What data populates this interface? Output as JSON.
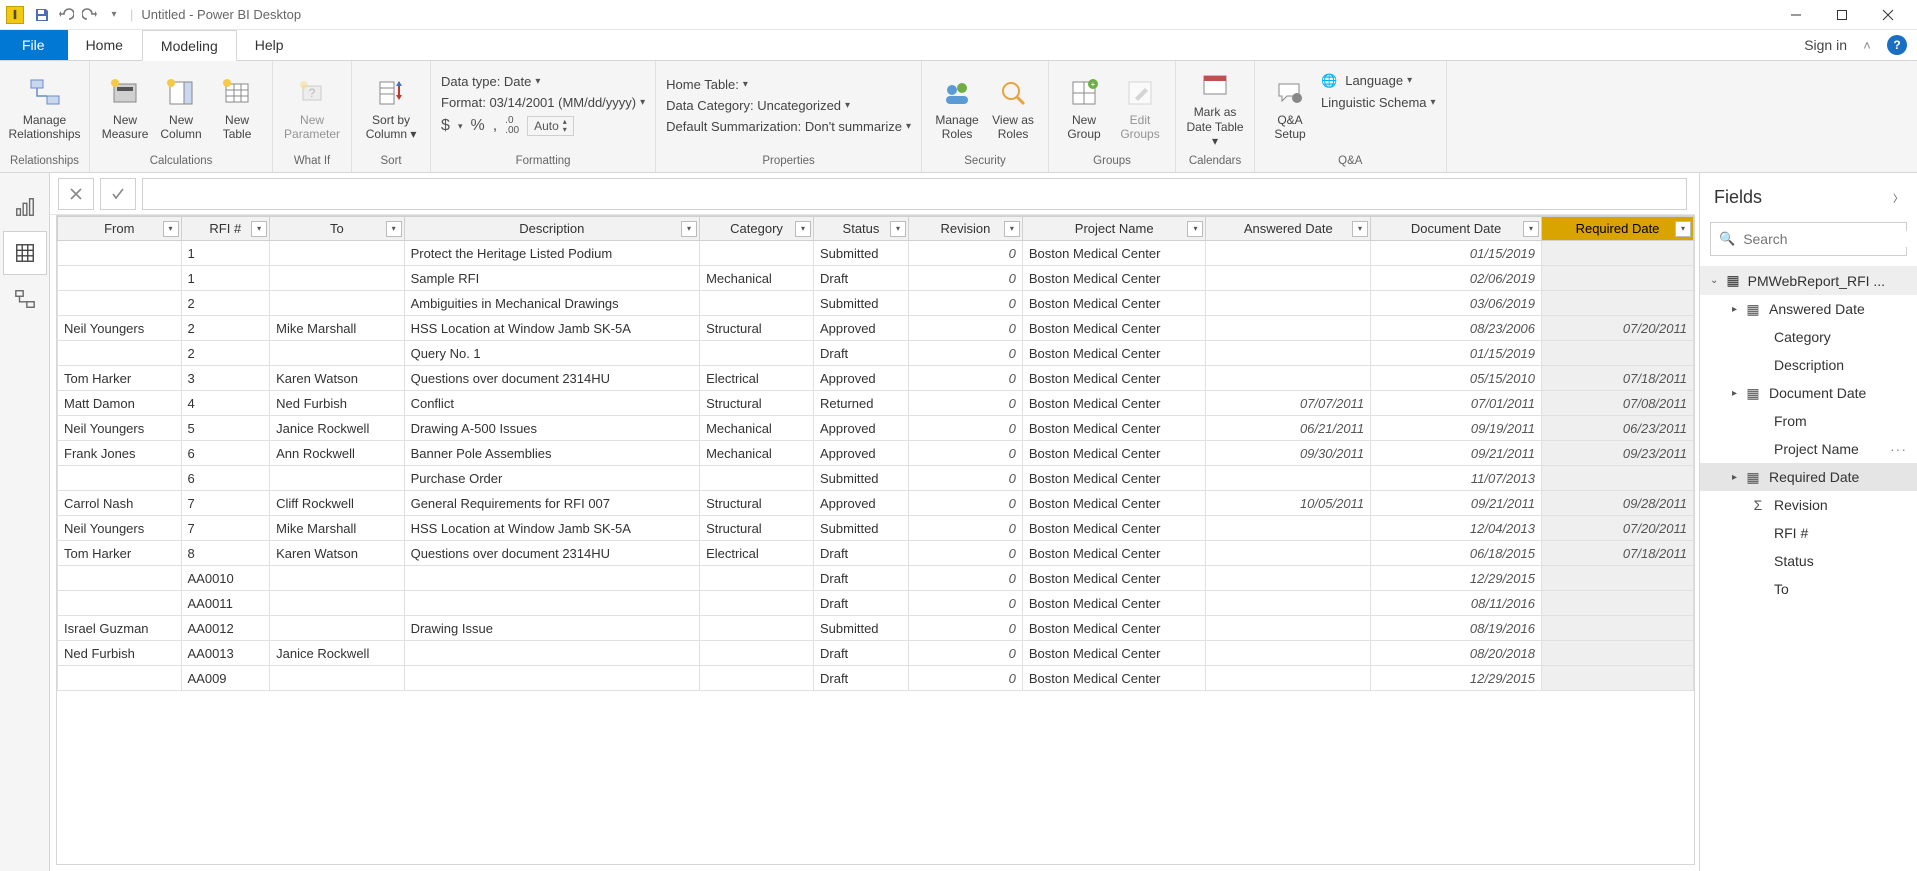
{
  "titlebar": {
    "title": "Untitled - Power BI Desktop"
  },
  "menubar": {
    "file": "File",
    "home": "Home",
    "modeling": "Modeling",
    "help": "Help",
    "signin": "Sign in"
  },
  "ribbon": {
    "relationships": {
      "manage": "Manage\nRelationships",
      "group": "Relationships"
    },
    "calculations": {
      "measure": "New\nMeasure",
      "column": "New\nColumn",
      "table": "New\nTable",
      "group": "Calculations"
    },
    "whatif": {
      "param": "New\nParameter",
      "group": "What If"
    },
    "sort": {
      "sortby": "Sort by\nColumn",
      "group": "Sort"
    },
    "formatting": {
      "datatype": "Data type: Date",
      "format": "Format: 03/14/2001 (MM/dd/yyyy)",
      "currency": "$",
      "percent": "%",
      "comma": ",",
      "decimals": ".0\n.00",
      "auto": "Auto",
      "group": "Formatting"
    },
    "properties": {
      "hometable": "Home Table:",
      "datacat": "Data Category: Uncategorized",
      "summ": "Default Summarization: Don't summarize",
      "group": "Properties"
    },
    "security": {
      "roles": "Manage\nRoles",
      "viewas": "View as\nRoles",
      "group": "Security"
    },
    "groups": {
      "new": "New\nGroup",
      "edit": "Edit\nGroups",
      "group": "Groups"
    },
    "calendars": {
      "mark": "Mark as\nDate Table",
      "group": "Calendars"
    },
    "qa": {
      "setup": "Q&A\nSetup",
      "lang": "Language",
      "schema": "Linguistic Schema",
      "group": "Q&A"
    }
  },
  "fields": {
    "title": "Fields",
    "search_ph": "Search",
    "table": "PMWebReport_RFI ...",
    "items": [
      {
        "label": "Answered Date",
        "icon": "date",
        "chevron": true
      },
      {
        "label": "Category"
      },
      {
        "label": "Description"
      },
      {
        "label": "Document Date",
        "icon": "date",
        "chevron": true
      },
      {
        "label": "From"
      },
      {
        "label": "Project Name",
        "more": true
      },
      {
        "label": "Required Date",
        "icon": "date",
        "chevron": true,
        "selected": true
      },
      {
        "label": "Revision",
        "icon": "sigma"
      },
      {
        "label": "RFI #"
      },
      {
        "label": "Status"
      },
      {
        "label": "To"
      }
    ]
  },
  "columns": [
    "From",
    "RFI #",
    "To",
    "Description",
    "Category",
    "Status",
    "Revision",
    "Project Name",
    "Answered Date",
    "Document Date",
    "Required Date"
  ],
  "selected_column_index": 10,
  "rows": [
    {
      "from": "",
      "rfi": "1",
      "to": "",
      "desc": "Protect the Heritage Listed Podium",
      "cat": "",
      "stat": "Submitted",
      "rev": "0",
      "proj": "Boston Medical Center",
      "ans": "",
      "doc": "01/15/2019",
      "req": ""
    },
    {
      "from": "",
      "rfi": "1",
      "to": "",
      "desc": "Sample RFI",
      "cat": "Mechanical",
      "stat": "Draft",
      "rev": "0",
      "proj": "Boston Medical Center",
      "ans": "",
      "doc": "02/06/2019",
      "req": ""
    },
    {
      "from": "",
      "rfi": "2",
      "to": "",
      "desc": "Ambiguities in Mechanical Drawings",
      "cat": "",
      "stat": "Submitted",
      "rev": "0",
      "proj": "Boston Medical Center",
      "ans": "",
      "doc": "03/06/2019",
      "req": ""
    },
    {
      "from": "Neil Youngers",
      "rfi": "2",
      "to": "Mike Marshall",
      "desc": "HSS Location at Window Jamb SK-5A",
      "cat": "Structural",
      "stat": "Approved",
      "rev": "0",
      "proj": "Boston Medical Center",
      "ans": "",
      "doc": "08/23/2006",
      "req": "07/20/2011"
    },
    {
      "from": "",
      "rfi": "2",
      "to": "",
      "desc": "Query No. 1",
      "cat": "",
      "stat": "Draft",
      "rev": "0",
      "proj": "Boston Medical Center",
      "ans": "",
      "doc": "01/15/2019",
      "req": ""
    },
    {
      "from": "Tom Harker",
      "rfi": "3",
      "to": "Karen Watson",
      "desc": "Questions over document 2314HU",
      "cat": "Electrical",
      "stat": "Approved",
      "rev": "0",
      "proj": "Boston Medical Center",
      "ans": "",
      "doc": "05/15/2010",
      "req": "07/18/2011"
    },
    {
      "from": "Matt Damon",
      "rfi": "4",
      "to": "Ned Furbish",
      "desc": "Conflict",
      "cat": "Structural",
      "stat": "Returned",
      "rev": "0",
      "proj": "Boston Medical Center",
      "ans": "07/07/2011",
      "doc": "07/01/2011",
      "req": "07/08/2011"
    },
    {
      "from": "Neil Youngers",
      "rfi": "5",
      "to": "Janice Rockwell",
      "desc": "Drawing A-500 Issues",
      "cat": "Mechanical",
      "stat": "Approved",
      "rev": "0",
      "proj": "Boston Medical Center",
      "ans": "06/21/2011",
      "doc": "09/19/2011",
      "req": "06/23/2011"
    },
    {
      "from": "Frank Jones",
      "rfi": "6",
      "to": "Ann Rockwell",
      "desc": "Banner Pole Assemblies",
      "cat": "Mechanical",
      "stat": "Approved",
      "rev": "0",
      "proj": "Boston Medical Center",
      "ans": "09/30/2011",
      "doc": "09/21/2011",
      "req": "09/23/2011"
    },
    {
      "from": "",
      "rfi": "6",
      "to": "",
      "desc": "Purchase Order",
      "cat": "",
      "stat": "Submitted",
      "rev": "0",
      "proj": "Boston Medical Center",
      "ans": "",
      "doc": "11/07/2013",
      "req": ""
    },
    {
      "from": "Carrol Nash",
      "rfi": "7",
      "to": "Cliff Rockwell",
      "desc": "General Requirements for RFI 007",
      "cat": "Structural",
      "stat": "Approved",
      "rev": "0",
      "proj": "Boston Medical Center",
      "ans": "10/05/2011",
      "doc": "09/21/2011",
      "req": "09/28/2011"
    },
    {
      "from": "Neil Youngers",
      "rfi": "7",
      "to": "Mike Marshall",
      "desc": "HSS Location at Window Jamb SK-5A",
      "cat": "Structural",
      "stat": "Submitted",
      "rev": "0",
      "proj": "Boston Medical Center",
      "ans": "",
      "doc": "12/04/2013",
      "req": "07/20/2011"
    },
    {
      "from": "Tom Harker",
      "rfi": "8",
      "to": "Karen Watson",
      "desc": "Questions over document 2314HU",
      "cat": "Electrical",
      "stat": "Draft",
      "rev": "0",
      "proj": "Boston Medical Center",
      "ans": "",
      "doc": "06/18/2015",
      "req": "07/18/2011"
    },
    {
      "from": "",
      "rfi": "AA0010",
      "to": "",
      "desc": "",
      "cat": "",
      "stat": "Draft",
      "rev": "0",
      "proj": "Boston Medical Center",
      "ans": "",
      "doc": "12/29/2015",
      "req": ""
    },
    {
      "from": "",
      "rfi": "AA0011",
      "to": "",
      "desc": "",
      "cat": "",
      "stat": "Draft",
      "rev": "0",
      "proj": "Boston Medical Center",
      "ans": "",
      "doc": "08/11/2016",
      "req": ""
    },
    {
      "from": "Israel Guzman",
      "rfi": "AA0012",
      "to": "",
      "desc": "Drawing Issue",
      "cat": "",
      "stat": "Submitted",
      "rev": "0",
      "proj": "Boston Medical Center",
      "ans": "",
      "doc": "08/19/2016",
      "req": ""
    },
    {
      "from": "Ned Furbish",
      "rfi": "AA0013",
      "to": "Janice Rockwell",
      "desc": "",
      "cat": "",
      "stat": "Draft",
      "rev": "0",
      "proj": "Boston Medical Center",
      "ans": "",
      "doc": "08/20/2018",
      "req": ""
    },
    {
      "from": "",
      "rfi": "AA009",
      "to": "",
      "desc": "",
      "cat": "",
      "stat": "Draft",
      "rev": "0",
      "proj": "Boston Medical Center",
      "ans": "",
      "doc": "12/29/2015",
      "req": ""
    }
  ]
}
